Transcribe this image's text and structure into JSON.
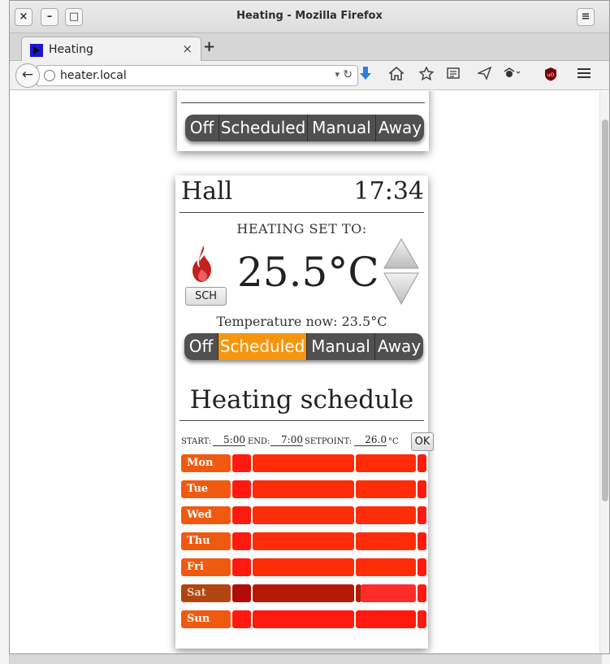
{
  "window": {
    "title": "Heating - Mozilla Firefox",
    "close_symbol": "×",
    "minimize_symbol": "–",
    "maximize_symbol": "□",
    "menu_symbol": "≡"
  },
  "tab": {
    "title": "Heating",
    "close_symbol": "×",
    "new_tab_symbol": "+"
  },
  "navbar": {
    "back_symbol": "←",
    "url": "heater.local",
    "dropdown_symbol": "▾",
    "reload_symbol": "↻",
    "icons": [
      "download-icon",
      "home-icon",
      "bookmark-star-icon",
      "reading-list-icon",
      "send-icon",
      "spy-extension-icon",
      "ublock-icon",
      "menu-icon"
    ]
  },
  "top_card": {
    "modes": [
      "Off",
      "Scheduled",
      "Manual",
      "Away"
    ]
  },
  "zone": {
    "room": "Hall",
    "time": "17:34",
    "set_to_label": "HEATING SET TO:",
    "setpoint": "25.5°C",
    "sch_button": "SCH",
    "temp_now": "Temperature now: 23.5°C",
    "modes": [
      "Off",
      "Scheduled",
      "Manual",
      "Away"
    ],
    "active_mode": "Scheduled",
    "colors": {
      "active_mode": "#f5960e",
      "mode": "#505050",
      "flame": "#c42020"
    }
  },
  "schedule": {
    "title": "Heating schedule",
    "editor": {
      "start_label": "START:",
      "start_value": "5:00",
      "end_label": "END:",
      "end_value": "7:00",
      "setpoint_label": "SETPOINT:",
      "setpoint_value": "26.0",
      "unit": "°C",
      "ok_button": "OK"
    },
    "day_label_color": "#f05a10",
    "days": [
      {
        "name": "Mon",
        "dim": false
      },
      {
        "name": "Tue",
        "dim": false
      },
      {
        "name": "Wed",
        "dim": false
      },
      {
        "name": "Thu",
        "dim": false
      },
      {
        "name": "Fri",
        "dim": false
      },
      {
        "name": "Sat",
        "dim": true
      },
      {
        "name": "Sun",
        "dim": false
      }
    ]
  }
}
